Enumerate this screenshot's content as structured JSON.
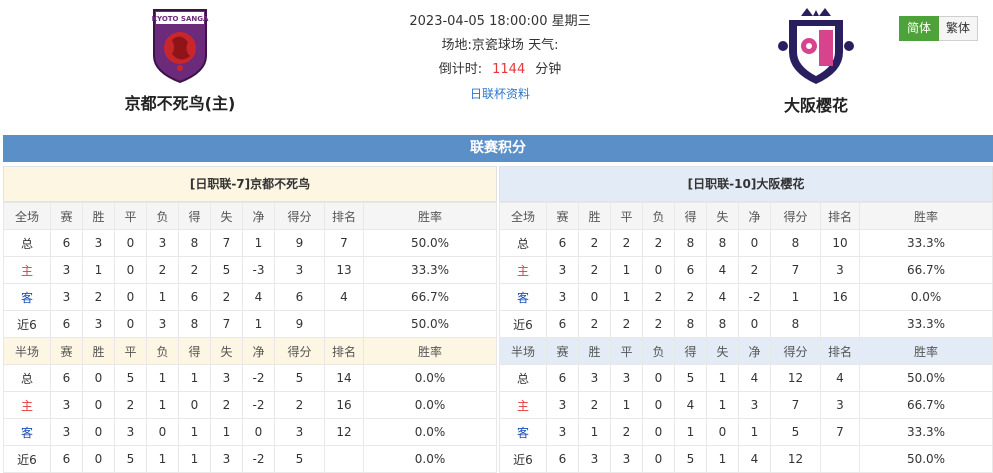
{
  "match": {
    "datetime": "2023-04-05 18:00:00 星期三",
    "venue_label": "场地:",
    "venue": "京瓷球场",
    "weather_label": "天气:",
    "countdown_label": "倒计时:",
    "countdown_value": "1144",
    "countdown_unit": "分钟",
    "info_link": "日联杯资料"
  },
  "home": {
    "name": "京都不死鸟(主)",
    "logo_text": "KYOTO SANGA"
  },
  "away": {
    "name": "大阪樱花"
  },
  "lang": {
    "simplified": "简体",
    "traditional": "繁体"
  },
  "section_title": "联赛积分",
  "columns_full": [
    "全场",
    "赛",
    "胜",
    "平",
    "负",
    "得",
    "失",
    "净",
    "得分",
    "排名",
    "胜率"
  ],
  "columns_half": [
    "半场",
    "赛",
    "胜",
    "平",
    "负",
    "得",
    "失",
    "净",
    "得分",
    "排名",
    "胜率"
  ],
  "home_table": {
    "caption": "[日职联-7]京都不死鸟",
    "full": [
      [
        "总",
        "6",
        "3",
        "0",
        "3",
        "8",
        "7",
        "1",
        "9",
        "7",
        "50.0%"
      ],
      [
        "主",
        "3",
        "1",
        "0",
        "2",
        "2",
        "5",
        "-3",
        "3",
        "13",
        "33.3%"
      ],
      [
        "客",
        "3",
        "2",
        "0",
        "1",
        "6",
        "2",
        "4",
        "6",
        "4",
        "66.7%"
      ],
      [
        "近6",
        "6",
        "3",
        "0",
        "3",
        "8",
        "7",
        "1",
        "9",
        "",
        "50.0%"
      ]
    ],
    "half": [
      [
        "总",
        "6",
        "0",
        "5",
        "1",
        "1",
        "3",
        "-2",
        "5",
        "14",
        "0.0%"
      ],
      [
        "主",
        "3",
        "0",
        "2",
        "1",
        "0",
        "2",
        "-2",
        "2",
        "16",
        "0.0%"
      ],
      [
        "客",
        "3",
        "0",
        "3",
        "0",
        "1",
        "1",
        "0",
        "3",
        "12",
        "0.0%"
      ],
      [
        "近6",
        "6",
        "0",
        "5",
        "1",
        "1",
        "3",
        "-2",
        "5",
        "",
        "0.0%"
      ]
    ]
  },
  "away_table": {
    "caption": "[日职联-10]大阪樱花",
    "full": [
      [
        "总",
        "6",
        "2",
        "2",
        "2",
        "8",
        "8",
        "0",
        "8",
        "10",
        "33.3%"
      ],
      [
        "主",
        "3",
        "2",
        "1",
        "0",
        "6",
        "4",
        "2",
        "7",
        "3",
        "66.7%"
      ],
      [
        "客",
        "3",
        "0",
        "1",
        "2",
        "2",
        "4",
        "-2",
        "1",
        "16",
        "0.0%"
      ],
      [
        "近6",
        "6",
        "2",
        "2",
        "2",
        "8",
        "8",
        "0",
        "8",
        "",
        "33.3%"
      ]
    ],
    "half": [
      [
        "总",
        "6",
        "3",
        "3",
        "0",
        "5",
        "1",
        "4",
        "12",
        "4",
        "50.0%"
      ],
      [
        "主",
        "3",
        "2",
        "1",
        "0",
        "4",
        "1",
        "3",
        "7",
        "3",
        "66.7%"
      ],
      [
        "客",
        "3",
        "1",
        "2",
        "0",
        "1",
        "0",
        "1",
        "5",
        "7",
        "33.3%"
      ],
      [
        "近6",
        "6",
        "3",
        "3",
        "0",
        "5",
        "1",
        "4",
        "12",
        "",
        "50.0%"
      ]
    ]
  },
  "colors": {
    "accent": "#5a8fc8",
    "home_red": "#e4393c",
    "away_blue": "#1a4fb5",
    "lang_active": "#4ea23a"
  }
}
